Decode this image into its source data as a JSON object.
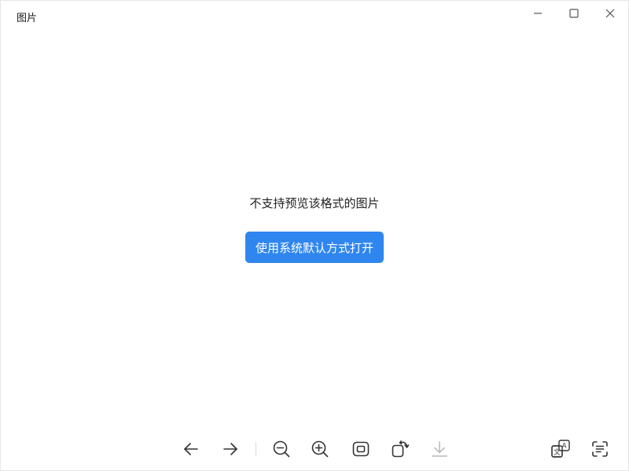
{
  "window": {
    "title": "图片"
  },
  "content": {
    "message": "不支持预览该格式的图片",
    "open_button_label": "使用系统默认方式打开"
  },
  "colors": {
    "accent": "#2f86ee",
    "icon": "#333333",
    "icon_disabled": "#b5b5b5"
  },
  "toolbar": {
    "items": [
      {
        "icon": "arrow-left-icon"
      },
      {
        "icon": "arrow-right-icon"
      },
      {
        "icon": "zoom-out-icon"
      },
      {
        "icon": "zoom-in-icon"
      },
      {
        "icon": "fit-to-window-icon"
      },
      {
        "icon": "rotate-icon"
      },
      {
        "icon": "download-icon",
        "disabled": true
      },
      {
        "icon": "translate-icon"
      },
      {
        "icon": "text-recognition-icon"
      }
    ]
  }
}
